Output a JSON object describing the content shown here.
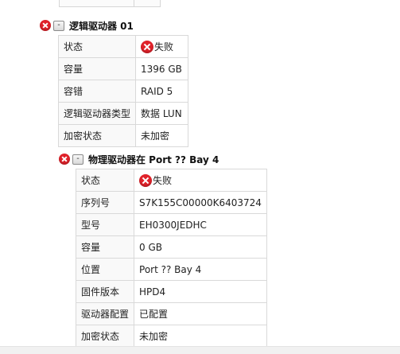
{
  "logical_drive": {
    "title": "逻辑驱动器 01",
    "collapse_label": "-",
    "status_icon": "error-x-icon",
    "rows": [
      {
        "key": "状态",
        "value": "失败",
        "status": true
      },
      {
        "key": "容量",
        "value": "1396 GB"
      },
      {
        "key": "容错",
        "value": "RAID 5"
      },
      {
        "key": "逻辑驱动器类型",
        "value": "数据 LUN"
      },
      {
        "key": "加密状态",
        "value": "未加密"
      }
    ]
  },
  "physical_drive": {
    "title": "物理驱动器在 Port ?? Bay 4",
    "collapse_label": "-",
    "status_icon": "error-x-icon",
    "rows": [
      {
        "key": "状态",
        "value": "失败",
        "status": true
      },
      {
        "key": "序列号",
        "value": "S7K155C00000K6403724"
      },
      {
        "key": "型号",
        "value": "EH0300JEDHC"
      },
      {
        "key": "容量",
        "value": "0 GB"
      },
      {
        "key": "位置",
        "value": "Port ?? Bay 4"
      },
      {
        "key": "固件版本",
        "value": "HPD4"
      },
      {
        "key": "驱动器配置",
        "value": "已配置"
      },
      {
        "key": "加密状态",
        "value": "未加密"
      }
    ]
  },
  "colors": {
    "error": "#e0222a",
    "border": "#d9d9d9",
    "key_bg": "#f9f9f9"
  }
}
